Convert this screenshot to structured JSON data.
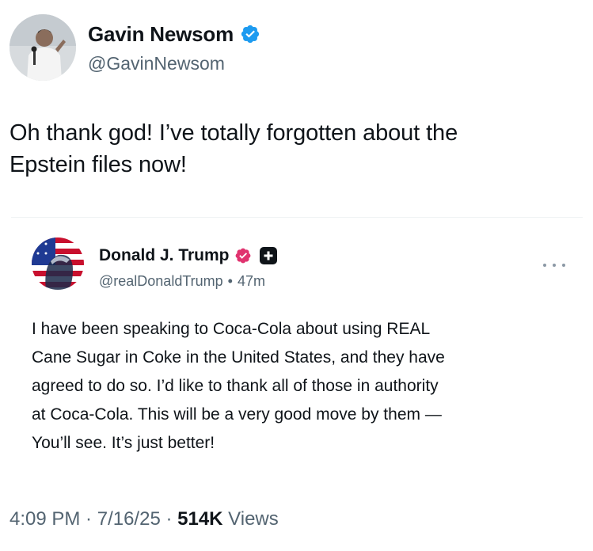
{
  "author": {
    "name": "Gavin Newsom",
    "handle": "@GavinNewsom",
    "avatar_icon": "person-avatar"
  },
  "tweet": {
    "lines": [
      "Oh thank god! I’ve totally forgotten about the",
      "Epstein files now!"
    ]
  },
  "quoted": {
    "name": "Donald J. Trump",
    "handle": "@realDonaldTrump",
    "separator": "•",
    "time": "47m",
    "badge_color": "#e0336f",
    "text_lines": [
      "I have been speaking to Coca-Cola about using REAL",
      "Cane Sugar in Coke in the United States, and they have",
      "agreed to do so. I’d like to thank all of those in authority",
      "at Coca-Cola. This will be a very good move by them —",
      "You’ll see. It’s just better!"
    ]
  },
  "footer": {
    "time": "4:09 PM",
    "sep1": " · ",
    "date": "7/16/25",
    "sep2": " · ",
    "views_count": "514K",
    "views_label": " Views"
  },
  "colors": {
    "verified_blue": "#1d9bf0",
    "secondary_text": "#536471"
  }
}
